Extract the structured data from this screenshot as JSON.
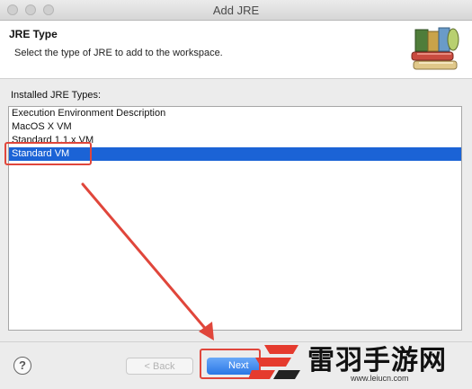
{
  "window": {
    "title": "Add JRE"
  },
  "header": {
    "title": "JRE Type",
    "description": "Select the type of JRE to add to the workspace."
  },
  "list": {
    "label": "Installed JRE Types:",
    "items": [
      {
        "label": "Execution Environment Description",
        "selected": false
      },
      {
        "label": "MacOS X VM",
        "selected": false
      },
      {
        "label": "Standard 1.1.x VM",
        "selected": false
      },
      {
        "label": "Standard VM",
        "selected": true
      }
    ]
  },
  "footer": {
    "help_icon": "?",
    "back_label": "< Back",
    "next_label": "Next"
  },
  "watermark": {
    "text": "雷羽手游网",
    "url": "www.leiucn.com"
  },
  "colors": {
    "selection": "#1b63d6",
    "annotation": "#e0463b",
    "primary_button": "#2a77e6"
  }
}
